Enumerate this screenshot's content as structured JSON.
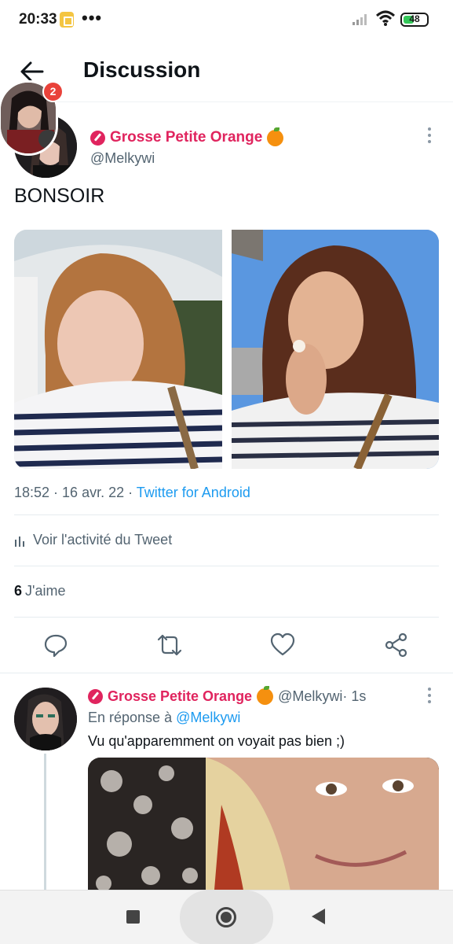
{
  "status_bar": {
    "time": "20:33",
    "dots": "•••",
    "battery": "48",
    "battery_level": 0.48
  },
  "header": {
    "title": "Discussion"
  },
  "story_badge_count": "2",
  "tweet": {
    "author_name": "Grosse Petite Orange",
    "handle": "@Melkywi",
    "text": "BONSOIR",
    "time": "18:52",
    "separator": " · ",
    "date": "16 avr. 22",
    "source": "Twitter for Android",
    "activity_label": "Voir l'activité du Tweet",
    "likes_count": "6",
    "likes_label": "J'aime"
  },
  "reply": {
    "author_name": "Grosse Petite Orange",
    "handle": "@Melkywi",
    "time": " · 1s",
    "in_reply_prefix": "En réponse à ",
    "in_reply_handle": "@Melkywi",
    "text": "Vu qu'apparemment on voyait pas bien ;)"
  },
  "colors": {
    "accent_pink": "#e0245e",
    "link_blue": "#1d9bf0",
    "muted": "#536471"
  },
  "icons": {
    "back": "arrow-left-icon",
    "more": "more-vertical-icon",
    "reply": "comment-icon",
    "retweet": "retweet-icon",
    "like": "heart-icon",
    "share": "share-icon"
  }
}
